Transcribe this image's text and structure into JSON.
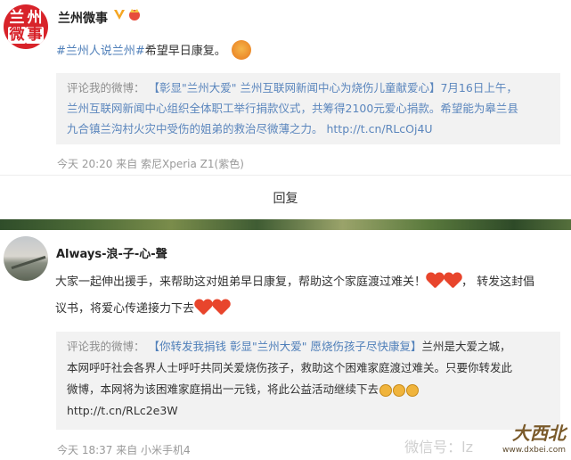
{
  "post1": {
    "account_name": "兰州微事",
    "avatar_chars": [
      "兰",
      "州",
      "微",
      "事"
    ],
    "text_tag": "#兰州人说兰州#",
    "text_body": "希望早日康复。",
    "quote_label": "评论我的微博：",
    "quote_line1": "【彰显\"兰州大爱\" 兰州互联网新闻中心为烧伤儿童献爱心】7月16日上午，",
    "quote_line2": "兰州互联网新闻中心组织全体职工举行捐款仪式，共筹得2100元爱心捐款。希望能为皋兰县",
    "quote_line3": "九合镇兰沟村火灾中受伤的姐弟的救治尽微薄之力。 http://t.cn/RLcOj4U",
    "meta": "今天 20:20 来自 索尼Xperia Z1(紫色)"
  },
  "reply_label": "回复",
  "post2": {
    "account_name": "Always-浪-子-心-聲",
    "text_part1": "大家一起伸出援手，来帮助这对姐弟早日康复，帮助这个家庭渡过难关！",
    "text_part2": "， 转发这封倡",
    "text_part3": "议书，将爱心传递接力下去",
    "quote_label": "评论我的微博：",
    "quote_title": "【你转发我捐钱 彰显\"兰州大爱\" 愿烧伤孩子尽快康复】",
    "quote_line1_tail": "兰州是大爱之城，",
    "quote_line2": "本网呼吁社会各界人士呼吁共同关爱烧伤孩子，救助这个困难家庭渡过难关。只要你转发此",
    "quote_line3": "微博，本网将为该困难家庭捐出一元钱，将此公益活动继续下去",
    "quote_link": "http://t.cn/RLc2e3W",
    "meta": "今天 18:37 来自 小米手机4"
  },
  "watermark": "微信号：lz",
  "site_logo_text": "大西北",
  "site_logo_url": "www.dxbei.com",
  "colors": {
    "link_blue": "#4f7fb9",
    "quote_bg": "#f2f2f2",
    "brand_red": "#d8232a",
    "meta_gray": "#999999"
  }
}
